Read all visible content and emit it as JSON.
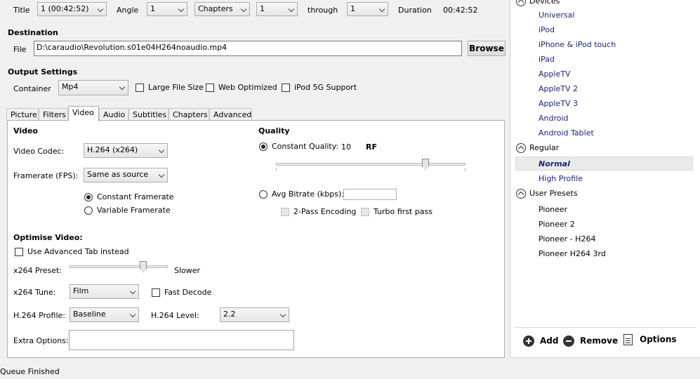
{
  "source": {
    "title_label": "Title",
    "title_value": "1 (00:42:52)",
    "angle_label": "Angle",
    "angle_value": "1",
    "range_type": "Chapters",
    "range_start": "1",
    "through_label": "through",
    "range_end": "1",
    "duration_label": "Duration",
    "duration_value": "00:42:52"
  },
  "destination": {
    "heading": "Destination",
    "file_label": "File",
    "file_value": "D:\\caraudio\\Revolution.s01e04H264noaudio.mp4",
    "browse_label": "Browse"
  },
  "output": {
    "heading": "Output Settings",
    "container_label": "Container",
    "container_value": "Mp4",
    "large_file_label": "Large File Size",
    "web_optimized_label": "Web Optimized",
    "ipod_label": "iPod 5G Support"
  },
  "tabs": [
    {
      "label": "Picture"
    },
    {
      "label": "Filters"
    },
    {
      "label": "Video"
    },
    {
      "label": "Audio"
    },
    {
      "label": "Subtitles"
    },
    {
      "label": "Chapters"
    },
    {
      "label": "Advanced"
    }
  ],
  "video": {
    "heading": "Video",
    "codec_label": "Video Codec:",
    "codec_value": "H.264 (x264)",
    "framerate_label": "Framerate (FPS):",
    "framerate_value": "Same as source",
    "constant_framerate": "Constant Framerate",
    "variable_framerate": "Variable Framerate"
  },
  "quality": {
    "heading": "Quality",
    "constant_label": "Constant Quality:",
    "constant_value": "10",
    "rf_label": "RF",
    "rf_slider_level": 0.8,
    "avg_bitrate_label": "Avg Bitrate (kbps):",
    "avg_bitrate_value": "",
    "two_pass_label": "2-Pass Encoding",
    "turbo_label": "Turbo first pass"
  },
  "optimise": {
    "heading": "Optimise Video:",
    "advanced_tab_label": "Use Advanced Tab instead",
    "preset_label": "x264 Preset:",
    "preset_value": "Slower",
    "preset_slider_level": 0.77,
    "tune_label": "x264 Tune:",
    "tune_value": "Film",
    "fast_decode_label": "Fast Decode",
    "profile_label": "H.264 Profile:",
    "profile_value": "Baseline",
    "level_label": "H.264 Level:",
    "level_value": "2.2",
    "extra_label": "Extra Options:",
    "extra_value": ""
  },
  "presets": {
    "devices_label": "Devices",
    "devices": [
      "Universal",
      "iPod",
      "iPhone & iPod touch",
      "iPad",
      "AppleTV",
      "AppleTV 2",
      "AppleTV 3",
      "Android",
      "Android Tablet"
    ],
    "regular_label": "Regular",
    "regular": [
      "Normal",
      "High Profile"
    ],
    "user_label": "User Presets",
    "user": [
      "Pioneer",
      "Pioneer 2",
      "Pioneer - H264",
      "Pioneer H264 3rd"
    ],
    "add_label": "Add",
    "remove_label": "Remove",
    "options_label": "Options"
  },
  "status": {
    "text": "Queue Finished"
  }
}
